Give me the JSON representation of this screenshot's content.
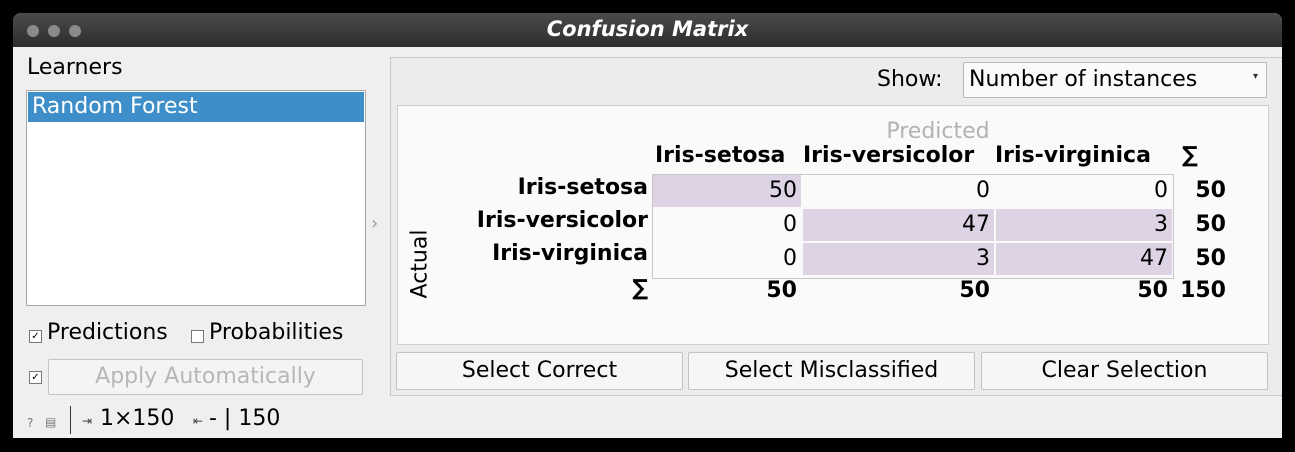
{
  "window": {
    "title": "Confusion Matrix"
  },
  "left": {
    "learners_label": "Learners",
    "learners": [
      "Random Forest"
    ],
    "predictions_label": "Predictions",
    "predictions_checked": true,
    "probabilities_label": "Probabilities",
    "probabilities_checked": false,
    "apply_checked": true,
    "apply_label": "Apply Automatically"
  },
  "status": {
    "input": "1×150",
    "output": "- | 150"
  },
  "show": {
    "label": "Show:",
    "value": "Number of instances"
  },
  "matrix": {
    "predicted_label": "Predicted",
    "actual_label": "Actual",
    "sum_symbol": "∑",
    "classes": [
      "Iris-setosa",
      "Iris-versicolor",
      "Iris-virginica"
    ],
    "values": [
      [
        "50",
        "0",
        "0"
      ],
      [
        "0",
        "47",
        "3"
      ],
      [
        "0",
        "3",
        "47"
      ]
    ],
    "row_sums": [
      "50",
      "50",
      "50"
    ],
    "col_sums": [
      "50",
      "50",
      "50"
    ],
    "total": "150",
    "highlight_color": "#ddd3e5"
  },
  "buttons": {
    "select_correct": "Select Correct",
    "select_misclassified": "Select Misclassified",
    "clear_selection": "Clear Selection"
  }
}
